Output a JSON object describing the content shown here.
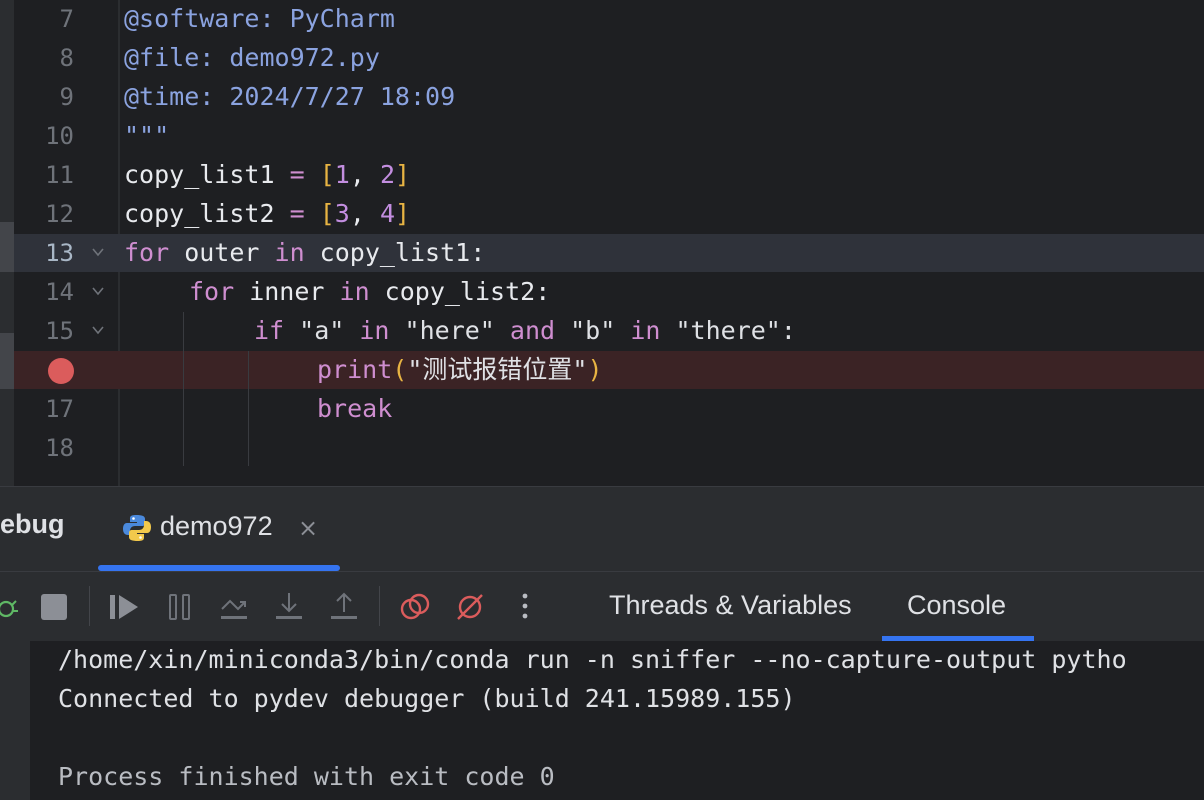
{
  "editor": {
    "lines": [
      {
        "num": "7",
        "text": "@software: PyCharm"
      },
      {
        "num": "8",
        "text": "@file: demo972.py"
      },
      {
        "num": "9",
        "text": "@time: 2024/7/27 18:09"
      },
      {
        "num": "10",
        "text": "\"\"\""
      },
      {
        "num": "11",
        "a": "copy_list1 ",
        "b": "=",
        "c": " ",
        "d": "[",
        "e": "1",
        "f": ", ",
        "g": "2",
        "h": "]"
      },
      {
        "num": "12",
        "a": "copy_list2 ",
        "b": "=",
        "c": " ",
        "d": "[",
        "e": "3",
        "f": ", ",
        "g": "4",
        "h": "]"
      },
      {
        "num": "13",
        "kw1": "for",
        "v1": " outer ",
        "kw2": "in",
        "v2": " copy_list1:"
      },
      {
        "num": "14",
        "kw1": "for",
        "v1": " inner ",
        "kw2": "in",
        "v2": " copy_list2:"
      },
      {
        "num": "15",
        "kw1": "if",
        "s1": " \"a\" ",
        "kw2": "in",
        "s2": " \"here\" ",
        "kw3": "and",
        "s3": " \"b\" ",
        "kw4": "in",
        "s4": " \"there\":"
      },
      {
        "num": "",
        "fn": "print",
        "p1": "(",
        "str": "\"测试报错位置\"",
        "p2": ")"
      },
      {
        "num": "17",
        "kw1": "break"
      },
      {
        "num": "18"
      }
    ]
  },
  "tool_window": {
    "title": "ebug",
    "run_tab_label": "demo972",
    "close_glyph": "×"
  },
  "debug_subtabs": [
    "Threads & Variables",
    "Console"
  ],
  "console": {
    "lines": [
      "/home/xin/miniconda3/bin/conda run -n sniffer --no-capture-output pytho",
      "Connected to pydev debugger (build 241.15989.155)",
      "",
      "Process finished with exit code 0"
    ]
  },
  "colors": {
    "accent": "#3574f0",
    "breakpoint": "#db5c5c",
    "keyword": "#cf8ed0",
    "docstring": "#8ba3e0",
    "bracket": "#e8b443"
  },
  "icons": [
    "python-file-icon",
    "close-icon",
    "rerun-debug-icon",
    "stop-icon",
    "resume-icon",
    "pause-icon",
    "step-over-icon",
    "step-into-icon",
    "step-out-icon",
    "view-breakpoints-icon",
    "mute-breakpoints-icon",
    "more-options-icon",
    "fold-arrow-icon",
    "breakpoint-icon"
  ]
}
